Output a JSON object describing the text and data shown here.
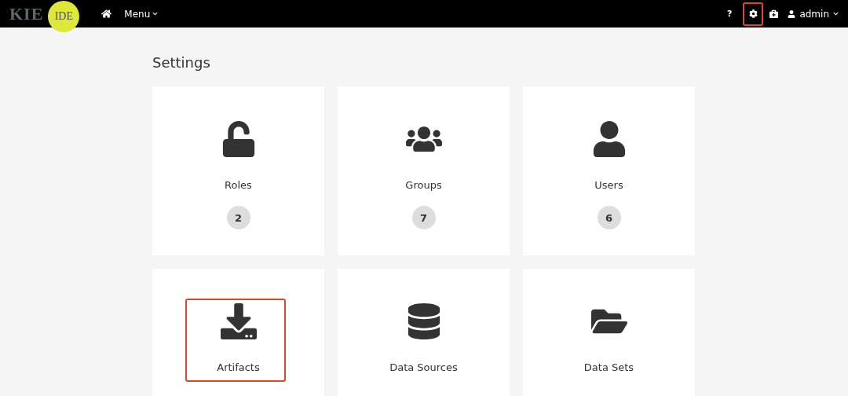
{
  "navbar": {
    "logo": {
      "left": "KIE",
      "badge": "IDE"
    },
    "menu": "Menu",
    "help": "?",
    "settings_highlighted": true,
    "user": "admin"
  },
  "page": {
    "title": "Settings"
  },
  "tiles": [
    {
      "label": "Roles",
      "count": "2",
      "highlighted": false
    },
    {
      "label": "Groups",
      "count": "7",
      "highlighted": false
    },
    {
      "label": "Users",
      "count": "6",
      "highlighted": false
    },
    {
      "label": "Artifacts",
      "highlighted": true
    },
    {
      "label": "Data Sources",
      "highlighted": false
    },
    {
      "label": "Data Sets",
      "highlighted": false
    }
  ]
}
